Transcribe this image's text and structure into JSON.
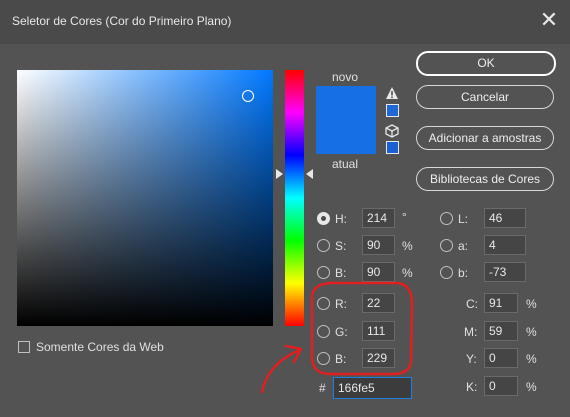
{
  "window": {
    "title": "Seletor de Cores (Cor do Primeiro Plano)",
    "close_icon": "close-icon"
  },
  "swatches": {
    "new_label": "novo",
    "current_label": "atual",
    "new_color": "#166fe5",
    "current_color": "#166fe5"
  },
  "buttons": {
    "ok": "OK",
    "cancel": "Cancelar",
    "add_to_swatches": "Adicionar a amostras",
    "color_libraries": "Bibliotecas de Cores"
  },
  "hsb": {
    "h": {
      "label": "H:",
      "value": "214",
      "unit": "°"
    },
    "s": {
      "label": "S:",
      "value": "90",
      "unit": "%"
    },
    "b": {
      "label": "B:",
      "value": "90",
      "unit": "%"
    }
  },
  "rgb": {
    "r": {
      "label": "R:",
      "value": "22"
    },
    "g": {
      "label": "G:",
      "value": "111"
    },
    "b": {
      "label": "B:",
      "value": "229"
    }
  },
  "lab": {
    "l": {
      "label": "L:",
      "value": "46"
    },
    "a": {
      "label": "a:",
      "value": "4"
    },
    "b": {
      "label": "b:",
      "value": "-73"
    }
  },
  "cmyk": {
    "c": {
      "label": "C:",
      "value": "91",
      "unit": "%"
    },
    "m": {
      "label": "M:",
      "value": "59",
      "unit": "%"
    },
    "y": {
      "label": "Y:",
      "value": "0",
      "unit": "%"
    },
    "k": {
      "label": "K:",
      "value": "0",
      "unit": "%"
    }
  },
  "hex": {
    "label": "#",
    "value": "166fe5"
  },
  "web_only": {
    "label": "Somente Cores da Web",
    "checked": false
  },
  "selected_mode": "H",
  "annotation_color": "#e02020"
}
